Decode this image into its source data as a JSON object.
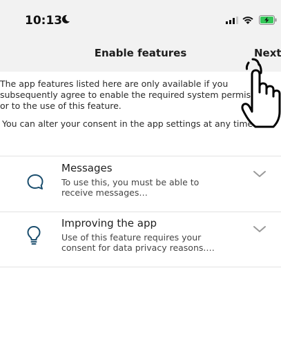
{
  "status_bar": {
    "time": "10:13",
    "icons": [
      "moon-icon",
      "signal-icon",
      "wifi-icon",
      "battery-charging-icon"
    ],
    "battery_color": "#34c759"
  },
  "nav": {
    "title": "Enable features",
    "next_label": "Next"
  },
  "intro": {
    "paragraph1": "The app features listed here are only available if you subsequently agree to enable the required system permissions or to the use of this feature.",
    "paragraph2": "You can alter your consent in the app settings at any time."
  },
  "features": [
    {
      "icon": "chat-bubble-icon",
      "title": "Messages",
      "description": "To use this, you must be able to receive messages…"
    },
    {
      "icon": "lightbulb-icon",
      "title": "Improving the app",
      "description": "Use of this feature requires your consent for data privacy reasons.…"
    }
  ],
  "colors": {
    "header_bg": "#f2f2f2",
    "content_bg": "#ffffff",
    "icon_color": "#1a4d6d",
    "chevron_color": "#9a9a9a"
  }
}
